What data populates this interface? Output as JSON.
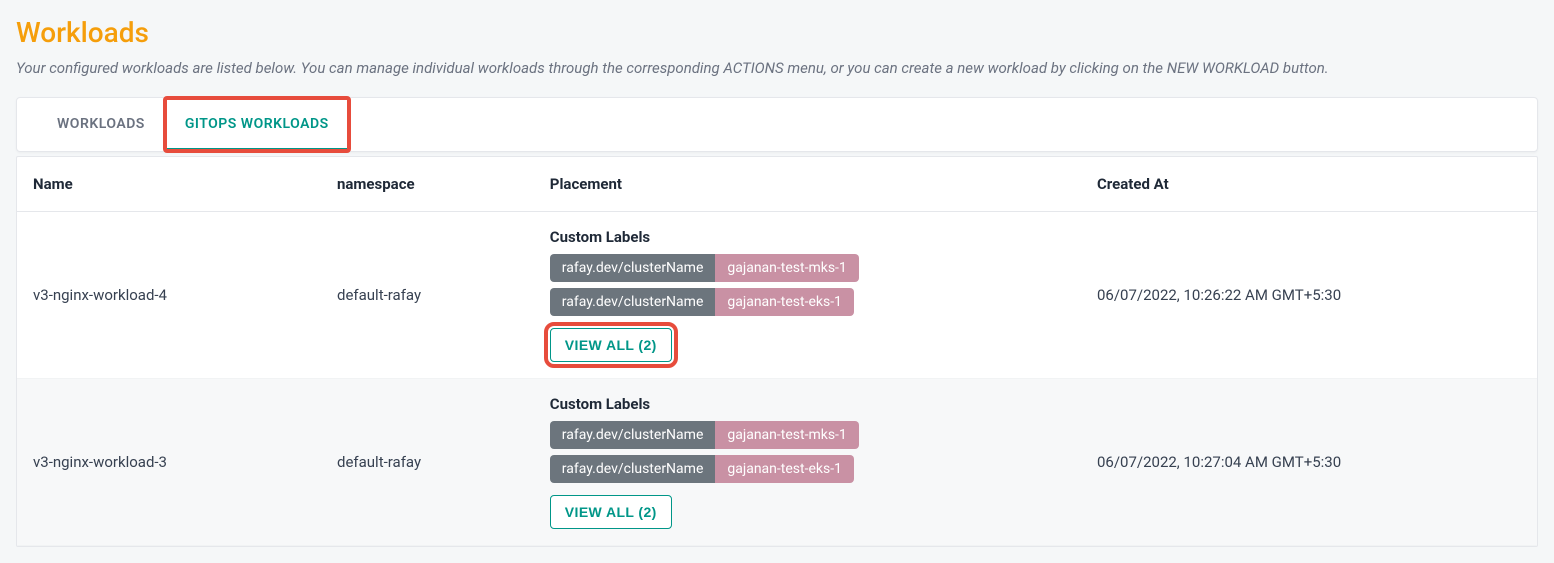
{
  "header": {
    "title": "Workloads",
    "subtitle": "Your configured workloads are listed below. You can manage individual workloads through the corresponding ACTIONS menu, or you can create a new workload by clicking on the NEW WORKLOAD button."
  },
  "tabs": {
    "workloads": "WORKLOADS",
    "gitops": "GITOPS WORKLOADS"
  },
  "table": {
    "headers": {
      "name": "Name",
      "namespace": "namespace",
      "placement": "Placement",
      "created_at": "Created At"
    },
    "rows": [
      {
        "name": "v3-nginx-workload-4",
        "namespace": "default-rafay",
        "placement_title": "Custom Labels",
        "labels": [
          {
            "key": "rafay.dev/clusterName",
            "value": "gajanan-test-mks-1"
          },
          {
            "key": "rafay.dev/clusterName",
            "value": "gajanan-test-eks-1"
          }
        ],
        "view_all": "VIEW ALL (2)",
        "created_at": "06/07/2022, 10:26:22 AM GMT+5:30",
        "highlight_view_all": true
      },
      {
        "name": "v3-nginx-workload-3",
        "namespace": "default-rafay",
        "placement_title": "Custom Labels",
        "labels": [
          {
            "key": "rafay.dev/clusterName",
            "value": "gajanan-test-mks-1"
          },
          {
            "key": "rafay.dev/clusterName",
            "value": "gajanan-test-eks-1"
          }
        ],
        "view_all": "VIEW ALL (2)",
        "created_at": "06/07/2022, 10:27:04 AM GMT+5:30",
        "highlight_view_all": false
      }
    ]
  }
}
